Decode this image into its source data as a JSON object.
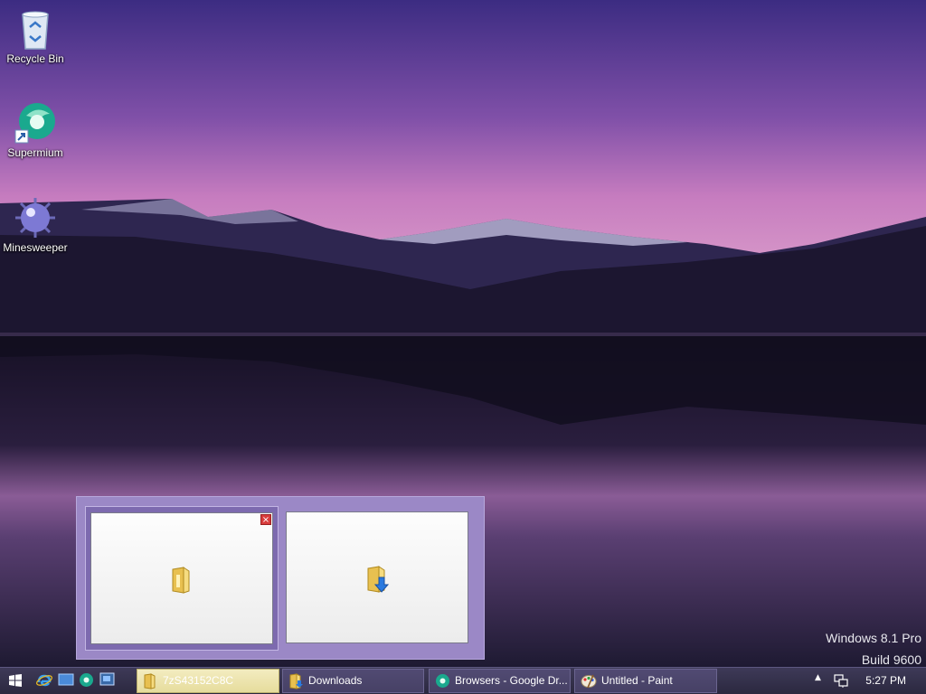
{
  "desktop": {
    "icons": [
      {
        "label": "Recycle Bin",
        "icon": "recycle-bin-icon"
      },
      {
        "label": "Supermium",
        "icon": "supermium-browser-icon"
      },
      {
        "label": "Minesweeper",
        "icon": "minesweeper-icon"
      }
    ],
    "watermark": {
      "line1": "Windows 8.1 Pro",
      "line2": "Build 9600"
    }
  },
  "flyout": {
    "thumbnails": [
      {
        "icon": "folder-icon",
        "active": true,
        "close_glyph": "×"
      },
      {
        "icon": "downloads-folder-icon",
        "active": false
      }
    ]
  },
  "taskbar": {
    "start_icon": "windows-logo-icon",
    "quick_launch": [
      "internet-explorer-icon",
      "show-desktop-icon",
      "supermium-icon",
      "switch-windows-icon"
    ],
    "buttons": [
      {
        "label": "7zS43152C8C",
        "icon": "folder-icon",
        "active": true
      },
      {
        "label": "Downloads",
        "icon": "downloads-folder-icon",
        "active": false
      },
      {
        "label": "Browsers - Google Dr...",
        "icon": "supermium-icon",
        "active": false
      },
      {
        "label": "Untitled - Paint",
        "icon": "paint-icon",
        "active": false
      }
    ],
    "tray": {
      "chevron": "▲",
      "network_icon": "network-icon",
      "clock": "5:27 PM"
    }
  },
  "colors": {
    "taskbar": "#2b283f",
    "flyout": "#9b88c6",
    "active_button": "#e6dc9c"
  }
}
